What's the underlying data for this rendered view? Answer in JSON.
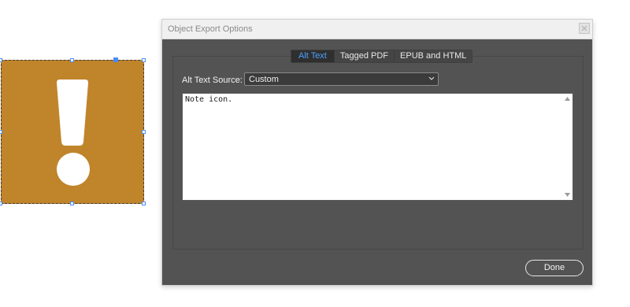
{
  "canvas": {
    "graphic_color": "#c0842b",
    "icon": "exclamation-icon",
    "selection_color": "#4a8cf7"
  },
  "dialog": {
    "title": "Object Export Options",
    "tabs": [
      {
        "label": "Alt Text",
        "active": true
      },
      {
        "label": "Tagged PDF",
        "active": false
      },
      {
        "label": "EPUB and HTML",
        "active": false
      }
    ],
    "alt_text_source": {
      "label": "Alt Text Source:",
      "value": "Custom"
    },
    "alt_text": "Note icon.",
    "done_label": "Done",
    "accent_color": "#4ba0ff"
  }
}
